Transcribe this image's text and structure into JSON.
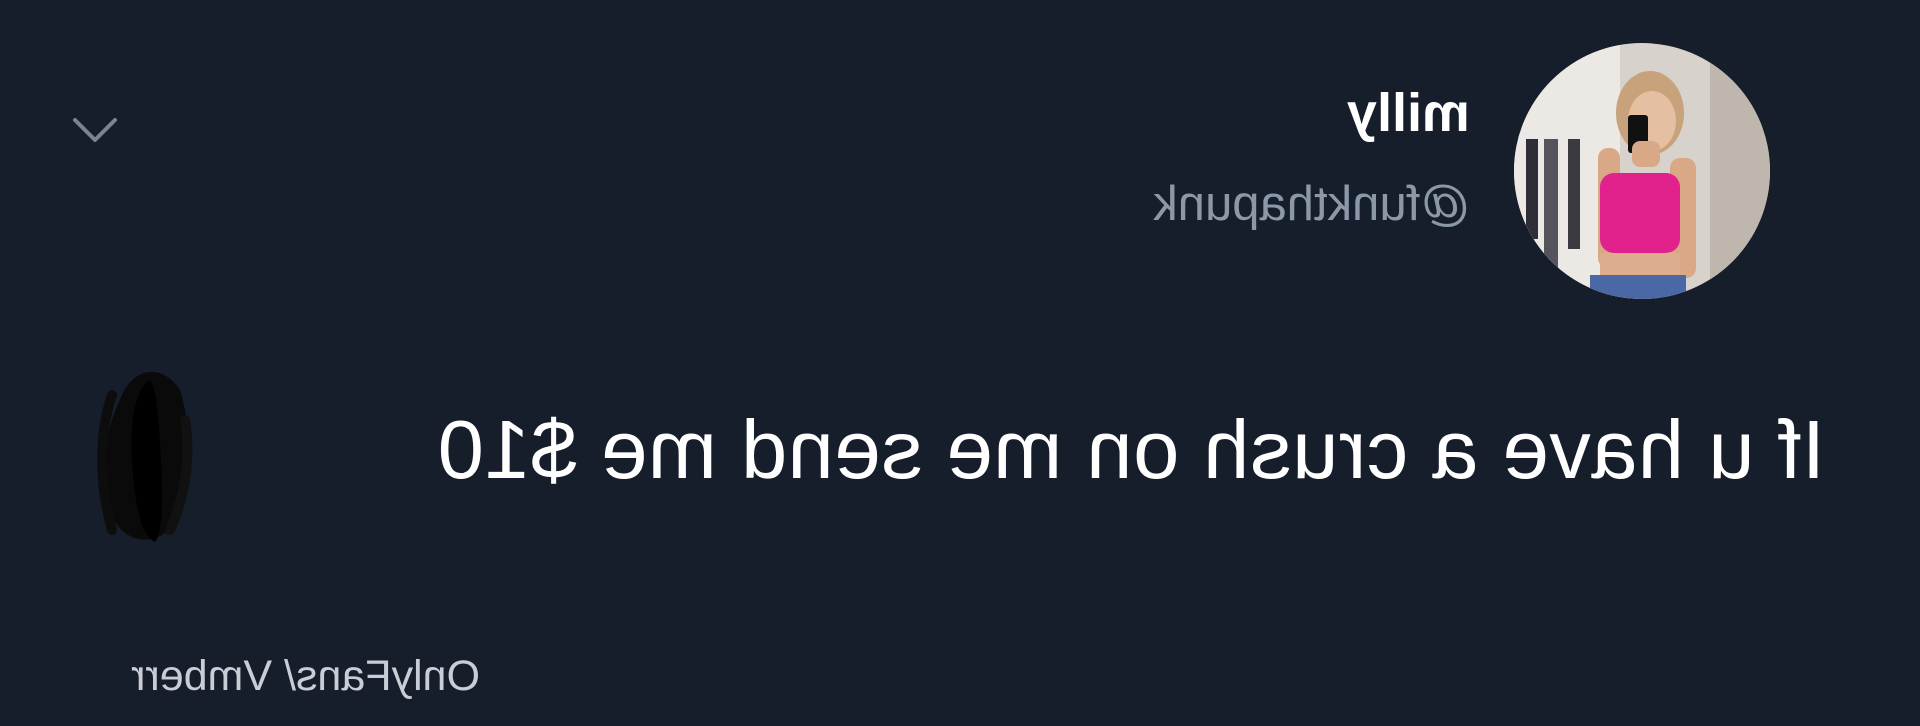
{
  "tweet": {
    "display_name": "milly",
    "handle": "@funkthapunk",
    "text": "If u have a crush on me send me $10",
    "menu_icon": "chevron-down-icon",
    "avatar_icon": "avatar"
  },
  "watermark": {
    "text": "OnlyFans/ Vmberr"
  },
  "colors": {
    "background": "#161d2b",
    "primary_text": "#ffffff",
    "secondary_text": "#8b98a8"
  },
  "image_state": {
    "mirrored_horizontally": true,
    "redaction": "black-scribble"
  }
}
